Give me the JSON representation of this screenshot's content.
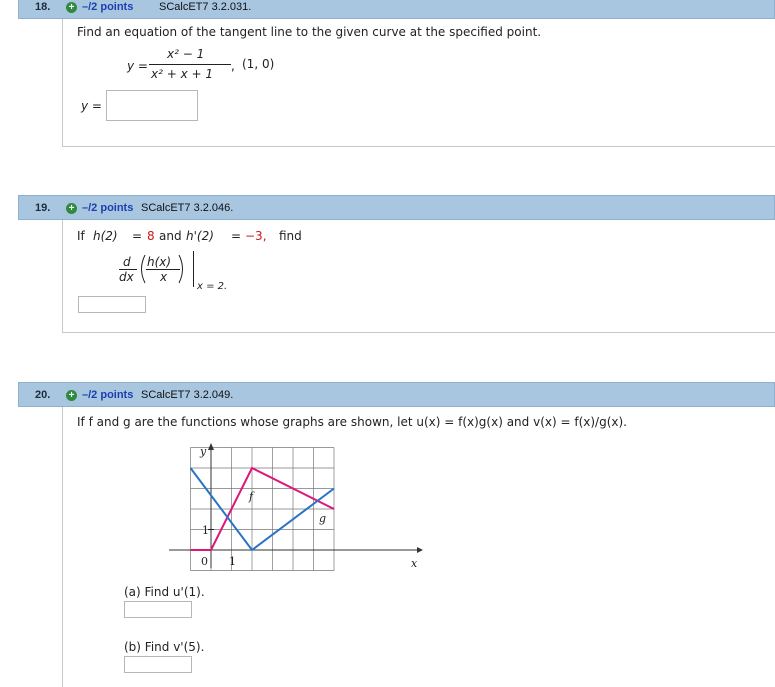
{
  "q18": {
    "num": "18.",
    "points": "–/2 points",
    "code": "SCalcET7 3.2.031.",
    "prompt": "Find an equation of the tangent line to the given curve at the specified point.",
    "y_eq": "y =",
    "numerator": "x² − 1",
    "denominator": "x² + x + 1",
    "comma": ",",
    "point": "(1, 0)",
    "answer_label": "y =",
    "answer_value": ""
  },
  "q19": {
    "num": "19.",
    "points": "–/2 points",
    "code": "SCalcET7 3.2.046.",
    "text_if": "If",
    "h2": "h(2)",
    "eq": "=",
    "val1": "8",
    "and": "and",
    "hp2": "h'(2)",
    "val2": "−3,",
    "find": "find",
    "d": "d",
    "dx": "dx",
    "hx": "h(x)",
    "x": "x",
    "eval": "x = 2.",
    "answer_value": ""
  },
  "q20": {
    "num": "20.",
    "points": "–/2 points",
    "code": "SCalcET7 3.2.049.",
    "prompt": "If f and g are the functions whose graphs are shown, let u(x) = f(x)g(x) and v(x) = f(x)/g(x).",
    "part_a": "(a) Find u'(1).",
    "part_b": "(b) Find v'(5).",
    "answer_a": "",
    "answer_b": "",
    "graph": {
      "y_label": "y",
      "x_label": "x",
      "origin_label": "0",
      "one_x_label": "1",
      "one_y_label": "1",
      "f_label": "f",
      "g_label": "g",
      "f_color": "#e0157a",
      "g_color": "#2a73c4"
    }
  },
  "chart_data": {
    "type": "line",
    "xlabel": "x",
    "ylabel": "y",
    "xlim": [
      -1,
      6
    ],
    "ylim": [
      -1,
      5
    ],
    "grid": true,
    "series": [
      {
        "name": "f",
        "x": [
          -1,
          0,
          2,
          6
        ],
        "y": [
          0,
          0,
          4,
          2
        ]
      },
      {
        "name": "g",
        "x": [
          -1,
          2,
          6
        ],
        "y": [
          4,
          0,
          3
        ]
      }
    ]
  }
}
